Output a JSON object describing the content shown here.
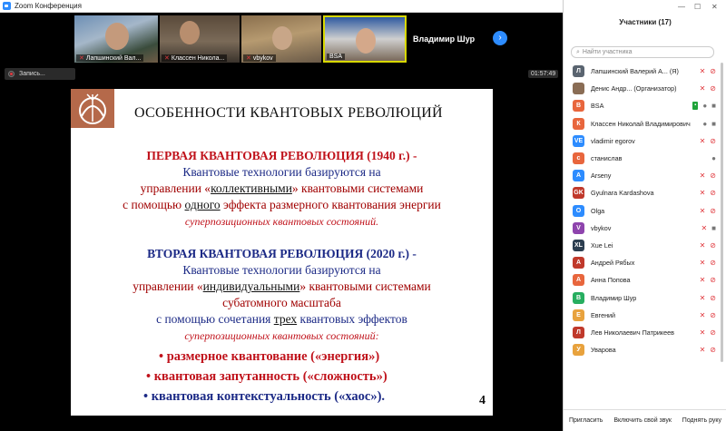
{
  "window": {
    "title": "Zoom Конференция"
  },
  "strip": {
    "thumbs": [
      {
        "label": "Лапшинский Вал..."
      },
      {
        "label": "Классен Никола..."
      },
      {
        "label": "vbykov"
      },
      {
        "label": "BSA"
      }
    ],
    "active_speaker": "Владимир Шур",
    "next_label": "›"
  },
  "recording": {
    "label": "Запись..."
  },
  "timer": "01:57:49",
  "slide": {
    "title": "ОСОБЕННОСТИ КВАНТОВЫХ РЕВОЛЮЦИЙ",
    "first_head": "ПЕРВАЯ КВАНТОВАЯ РЕВОЛЮЦИЯ (1940 г.)  -",
    "first_l1": "Квантовые технологии базируются на",
    "first_l2a": "управлении «",
    "first_l2b": "коллективными",
    "first_l2c": "» квантовыми системами",
    "first_l3a": "с помощью ",
    "first_l3b": "одного",
    "first_l3c": " эффекта размерного квантования энергии",
    "first_l4": "суперпозиционных квантовых состояний.",
    "second_head": "ВТОРАЯ КВАНТОВАЯ РЕВОЛЮЦИЯ (2020 г.)  -",
    "second_l1": "Квантовые технологии базируются на",
    "second_l2a": "управлении «",
    "second_l2b": "индивидуальными",
    "second_l2c": "» квантовыми системами",
    "second_l3": "субатомного масштаба",
    "second_l4a": "с помощью сочетания ",
    "second_l4b": "трех",
    "second_l4c": " квантовых эффектов",
    "second_l5": "суперпозиционных квантовых состояний:",
    "bullets": [
      "•    размерное квантование («энергия»)",
      "•    квантовая запутанность («сложность»)",
      "•    квантовая контекстуальность («хаос»)."
    ],
    "page_number": "4"
  },
  "panel": {
    "title": "Участники (17)",
    "search_placeholder": "Найти участника",
    "participants": [
      {
        "initial": "Л",
        "name": "Лапшинский Валерий А... (Я)",
        "color": "#5a6470",
        "icons": [
          "mic-off",
          "cam-off"
        ]
      },
      {
        "initial": "",
        "name": "Денис Андр... (Организатор)",
        "color": "#8a6d55",
        "icons": [
          "mic-off",
          "cam-off"
        ]
      },
      {
        "initial": "B",
        "name": "BSA",
        "color": "#e8663d",
        "icons": [
          "live",
          "mic",
          "cam"
        ]
      },
      {
        "initial": "К",
        "name": "Классен Николай Владимирович",
        "color": "#e8663d",
        "icons": [
          "mic",
          "cam"
        ]
      },
      {
        "initial": "VE",
        "name": "vladimir egorov",
        "color": "#2d8cff",
        "icons": [
          "mic-off",
          "cam-off"
        ]
      },
      {
        "initial": "с",
        "name": "станислав",
        "color": "#e8663d",
        "icons": [
          "mic"
        ]
      },
      {
        "initial": "A",
        "name": "Arseny",
        "color": "#2d8cff",
        "icons": [
          "mic-off",
          "cam-off"
        ]
      },
      {
        "initial": "GK",
        "name": "Gyulnara Kardashova",
        "color": "#c0392b",
        "icons": [
          "mic-off",
          "cam-off"
        ]
      },
      {
        "initial": "O",
        "name": "Olga",
        "color": "#2d8cff",
        "icons": [
          "mic-off",
          "cam-off"
        ]
      },
      {
        "initial": "V",
        "name": "vbykov",
        "color": "#8e44ad",
        "icons": [
          "mic-off",
          "cam"
        ]
      },
      {
        "initial": "XL",
        "name": "Xue Lei",
        "color": "#2c3e50",
        "icons": [
          "mic-off",
          "cam-off"
        ]
      },
      {
        "initial": "A",
        "name": "Андрей Рябых",
        "color": "#c0392b",
        "icons": [
          "mic-off",
          "cam-off"
        ]
      },
      {
        "initial": "A",
        "name": "Анна Попова",
        "color": "#e8663d",
        "icons": [
          "mic-off",
          "cam-off"
        ]
      },
      {
        "initial": "В",
        "name": "Владимир Шур",
        "color": "#27ae60",
        "icons": [
          "mic-off",
          "cam-off"
        ]
      },
      {
        "initial": "E",
        "name": "Евгений",
        "color": "#e8a23d",
        "icons": [
          "mic-off",
          "cam-off"
        ]
      },
      {
        "initial": "Л",
        "name": "Лев Николаевич Патрикеев",
        "color": "#c0392b",
        "icons": [
          "mic-off",
          "cam-off"
        ]
      },
      {
        "initial": "У",
        "name": "Уварова",
        "color": "#e8a23d",
        "icons": [
          "mic-off",
          "cam-off"
        ]
      }
    ],
    "buttons": [
      "Пригласить",
      "Включить свой звук",
      "Поднять руку"
    ]
  }
}
